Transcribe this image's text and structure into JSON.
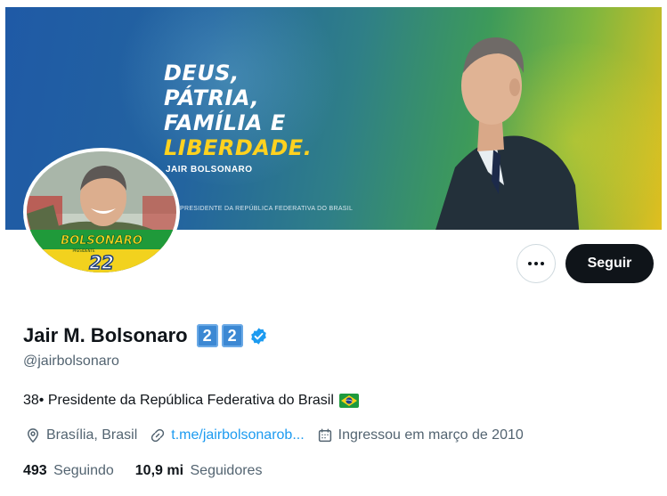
{
  "banner": {
    "slogan": [
      "DEUS,",
      "PÁTRIA,",
      "FAMÍLIA E",
      "LIBERDADE."
    ],
    "name": "JAIR BOLSONARO",
    "subtitle": "PRESIDENTE DA REPÚBLICA FEDERATIVA DO BRASIL"
  },
  "avatar": {
    "campaign_name": "BOLSONARO",
    "campaign_sub": "PRESIDENTE",
    "campaign_number": "22"
  },
  "actions": {
    "more_icon": "more-horizontal-icon",
    "follow_label": "Seguir"
  },
  "profile": {
    "display_name": "Jair M. Bolsonaro",
    "keycap_1": "2",
    "keycap_2": "2",
    "verified_icon": "verified-badge-icon",
    "handle": "@jairbolsonaro",
    "bio": "38• Presidente da República Federativa do Brasil",
    "bio_flag_icon": "brazil-flag-icon"
  },
  "meta": {
    "location": "Brasília, Brasil",
    "link": "t.me/jairbolsonarob...",
    "joined": "Ingressou em março de 2010"
  },
  "stats": {
    "following_count": "493",
    "following_label": "Seguindo",
    "followers_count": "10,9 mi",
    "followers_label": "Seguidores"
  },
  "colors": {
    "accent": "#1d9bf0",
    "text_primary": "#0f1419",
    "text_secondary": "#536471",
    "follow_button": "#0f1419",
    "keycap": "#3c88d3"
  }
}
